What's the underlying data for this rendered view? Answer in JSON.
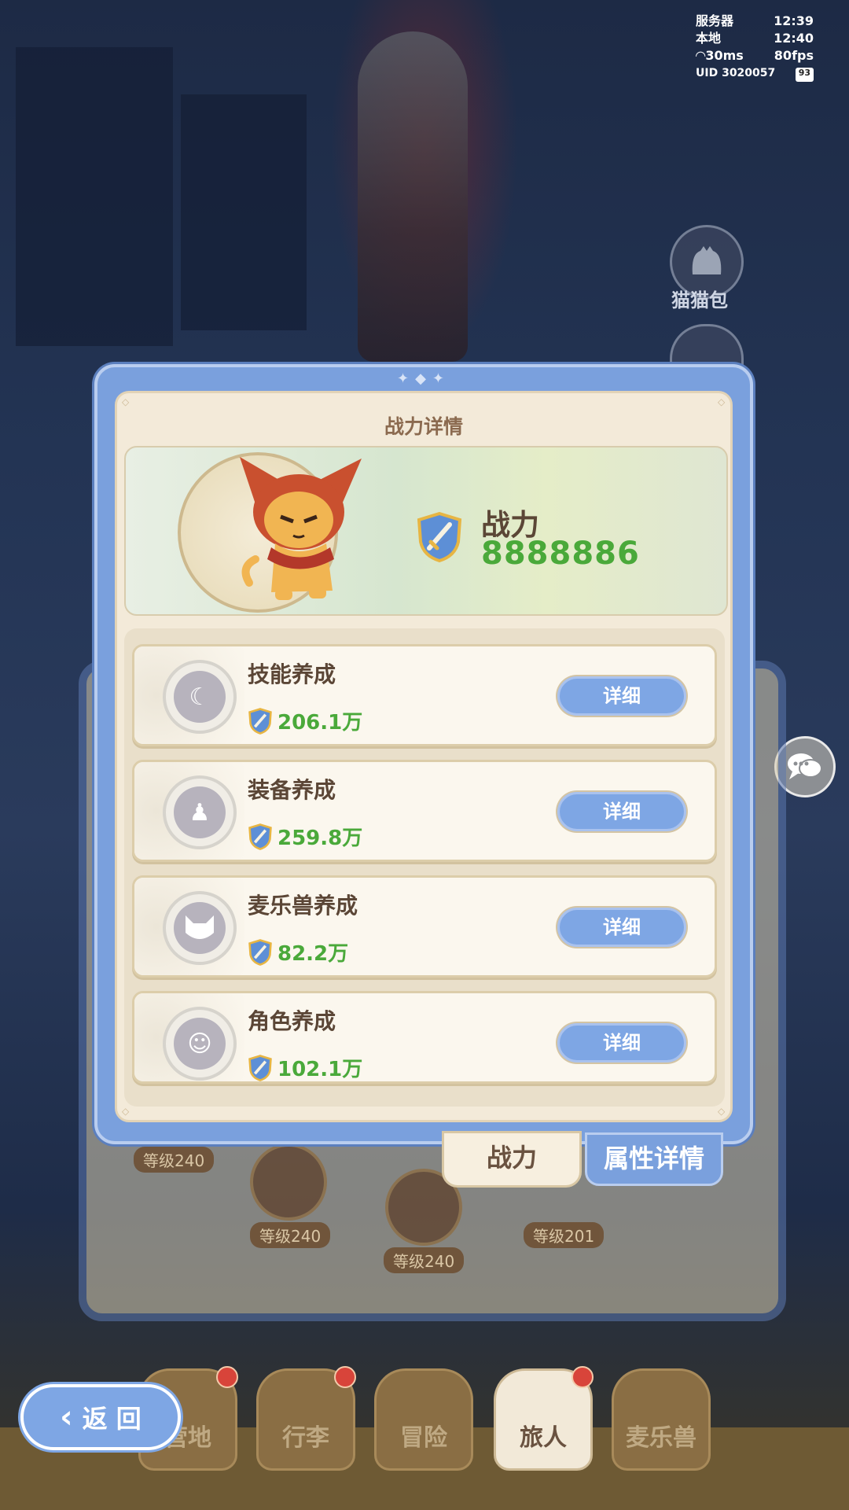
{
  "status": {
    "server_label": "服务器",
    "server_time": "12:39",
    "local_label": "本地",
    "local_time": "12:40",
    "ping": "30ms",
    "fps": "80fps",
    "uid": "UID 3020057",
    "battery": "93"
  },
  "side": {
    "bag_label": "猫猫包"
  },
  "background_levels": [
    "等级240",
    "等级240",
    "等级240",
    "等级201"
  ],
  "modal": {
    "title": "战力详情",
    "power_label": "战力",
    "power_value": "8888886",
    "items": [
      {
        "name": "技能养成",
        "value": "206.1万",
        "button": "详细",
        "icon": "moon-star-icon"
      },
      {
        "name": "装备养成",
        "value": "259.8万",
        "button": "详细",
        "icon": "cloak-icon"
      },
      {
        "name": "麦乐兽养成",
        "value": "82.2万",
        "button": "详细",
        "icon": "cat-face-icon"
      },
      {
        "name": "角色养成",
        "value": "102.1万",
        "button": "详细",
        "icon": "character-head-icon"
      }
    ]
  },
  "tabs": {
    "power": "战力",
    "attributes": "属性详情"
  },
  "nav": [
    {
      "label": "营地",
      "active": false,
      "dot": true
    },
    {
      "label": "行李",
      "active": false,
      "dot": true
    },
    {
      "label": "冒险",
      "active": false,
      "dot": false
    },
    {
      "label": "旅人",
      "active": true,
      "dot": true
    },
    {
      "label": "麦乐兽",
      "active": false,
      "dot": false
    }
  ],
  "back_button": "返 回",
  "colors": {
    "accent_blue": "#7aa0dd",
    "power_green": "#4aa93a",
    "text_brown": "#5b4636"
  }
}
